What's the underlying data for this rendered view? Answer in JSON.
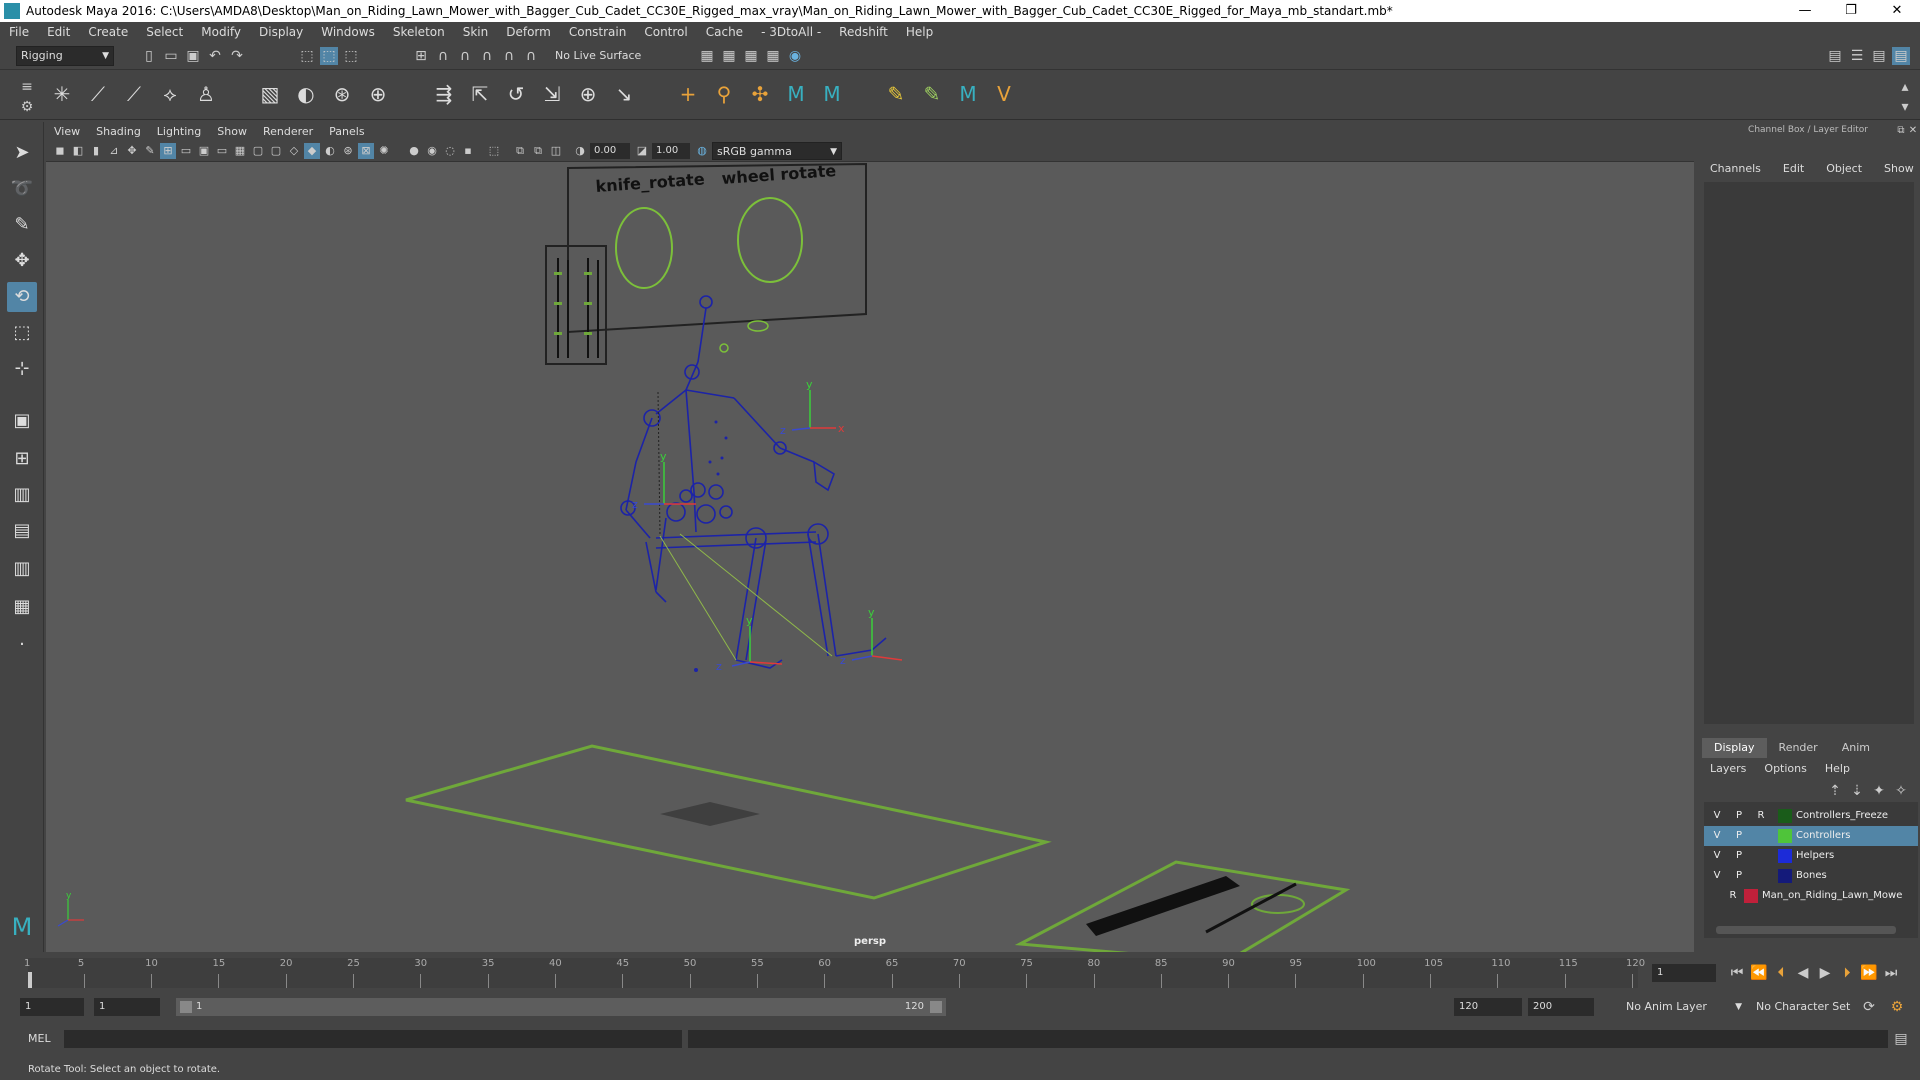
{
  "window": {
    "title": "Autodesk Maya 2016: C:\\Users\\AMDA8\\Desktop\\Man_on_Riding_Lawn_Mower_with_Bagger_Cub_Cadet_CC30E_Rigged_max_vray\\Man_on_Riding_Lawn_Mower_with_Bagger_Cub_Cadet_CC30E_Rigged_for_Maya_mb_standart.mb*",
    "controls": [
      "—",
      "❐",
      "✕"
    ]
  },
  "menubar": [
    "File",
    "Edit",
    "Create",
    "Select",
    "Modify",
    "Display",
    "Windows",
    "Skeleton",
    "Skin",
    "Deform",
    "Constrain",
    "Control",
    "Cache",
    "- 3DtoAll -",
    "Redshift",
    "Help"
  ],
  "statusline": {
    "menuset": "Rigging",
    "live_surface": "No Live Surface"
  },
  "panel": {
    "menus": [
      "View",
      "Shading",
      "Lighting",
      "Show",
      "Renderer",
      "Panels"
    ],
    "exposure": "0.00",
    "gamma": "1.00",
    "color_space": "sRGB gamma",
    "camera_label": "persp"
  },
  "viewport_text": {
    "knife_label": "knife_rotate",
    "wheel_label": "wheel rotate",
    "axis_x": "x",
    "axis_y": "y",
    "axis_z": "z"
  },
  "channel_box": {
    "title": "Channel Box / Layer Editor",
    "menus": [
      "Channels",
      "Edit",
      "Object",
      "Show"
    ]
  },
  "layer_editor": {
    "tabs": [
      "Display",
      "Render",
      "Anim"
    ],
    "menus": [
      "Layers",
      "Options",
      "Help"
    ],
    "layers": [
      {
        "v": "V",
        "p": "P",
        "r": "R",
        "name": "Controllers_Freeze",
        "color": "#1a5c1a",
        "selected": false
      },
      {
        "v": "V",
        "p": "P",
        "r": "",
        "name": "Controllers",
        "color": "#4fc43a",
        "selected": true
      },
      {
        "v": "V",
        "p": "P",
        "r": "",
        "name": "Helpers",
        "color": "#1c2bd8",
        "selected": false
      },
      {
        "v": "V",
        "p": "P",
        "r": "",
        "name": "Bones",
        "color": "#141a7a",
        "selected": false
      },
      {
        "v": "",
        "p": "",
        "r": "R",
        "name": "Man_on_Riding_Lawn_Mowe",
        "color": "#c0203a",
        "selected": false
      }
    ]
  },
  "timeline": {
    "ticks": [
      "1",
      "5",
      "10",
      "15",
      "20",
      "25",
      "30",
      "35",
      "40",
      "45",
      "50",
      "55",
      "60",
      "65",
      "70",
      "75",
      "80",
      "85",
      "90",
      "95",
      "100",
      "105",
      "110",
      "115",
      "120"
    ],
    "current_frame": "1"
  },
  "range": {
    "start": "1",
    "playback_start": "1",
    "slider_start": "1",
    "slider_end": "120",
    "playback_end": "120",
    "end": "200",
    "anim_layer": "No Anim Layer",
    "character_set": "No Character Set"
  },
  "command_line": {
    "label": "MEL"
  },
  "help_line": "Rotate Tool: Select an object to rotate."
}
